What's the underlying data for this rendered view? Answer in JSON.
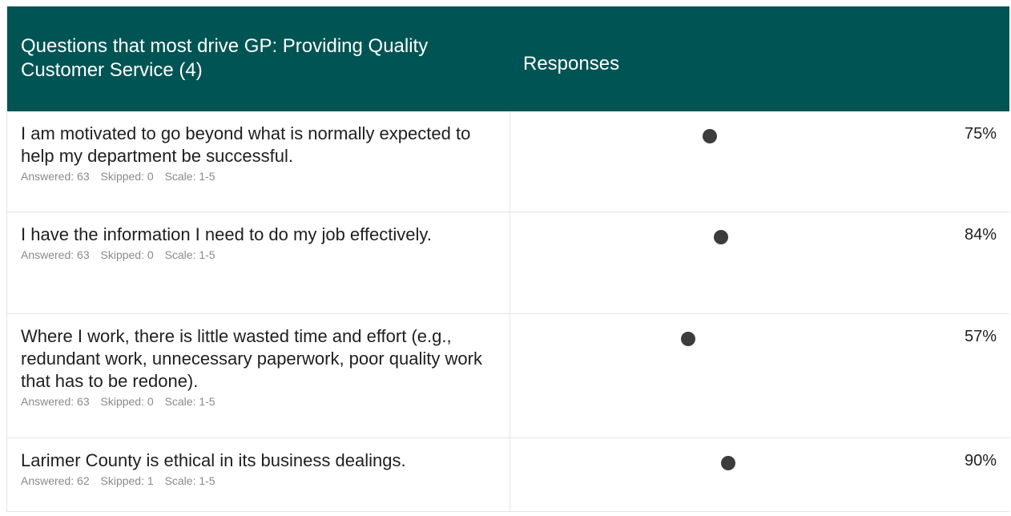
{
  "header": {
    "question_col": "Questions that most drive GP: Providing Quality Customer Service (4)",
    "responses_col": "Responses"
  },
  "rows": [
    {
      "question": "I am motivated to go beyond what is normally expected to help my department be successful.",
      "answered": "Answered: 63",
      "skipped": "Skipped: 0",
      "scale": "Scale: 1-5",
      "percent": "75%",
      "value": 75
    },
    {
      "question": "I have the information I need to do my job effectively.",
      "answered": "Answered: 63",
      "skipped": "Skipped: 0",
      "scale": "Scale: 1-5",
      "percent": "84%",
      "value": 84
    },
    {
      "question": "Where I work, there is little wasted time and effort (e.g., redundant work, unnecessary paperwork, poor quality work that has to be redone).",
      "answered": "Answered: 63",
      "skipped": "Skipped: 0",
      "scale": "Scale: 1-5",
      "percent": "57%",
      "value": 57
    },
    {
      "question": "Larimer County is ethical in its business dealings.",
      "answered": "Answered: 62",
      "skipped": "Skipped: 1",
      "scale": "Scale: 1-5",
      "percent": "90%",
      "value": 90
    }
  ],
  "colors": {
    "header_bg": "#015454",
    "dot": "#3c3c3c"
  }
}
